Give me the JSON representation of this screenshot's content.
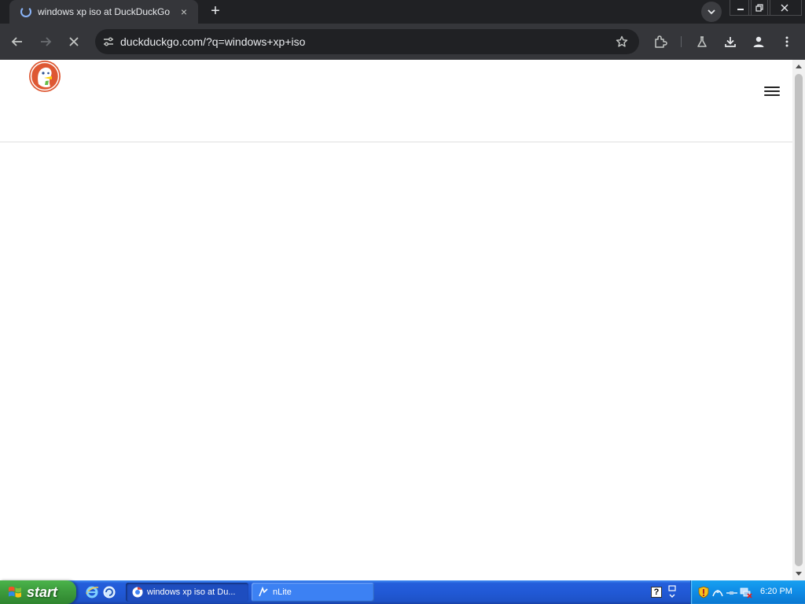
{
  "browser": {
    "tab": {
      "title": "windows xp iso at DuckDuckGo",
      "close_glyph": "×"
    },
    "new_tab_glyph": "+",
    "omnibox": {
      "url": "duckduckgo.com/?q=windows+xp+iso"
    },
    "icons": [
      "back-icon",
      "forward-icon",
      "stop-icon",
      "tune-icon",
      "star-icon",
      "extensions-icon",
      "labs-icon",
      "download-icon",
      "profile-icon",
      "menu-icon"
    ]
  },
  "page": {
    "site": "DuckDuckGo",
    "loading": true
  },
  "taskbar": {
    "start_label": "start",
    "tasks": [
      {
        "label": "windows xp iso at Du...",
        "active": true
      },
      {
        "label": "nLite",
        "active": false
      }
    ],
    "help_glyph": "?",
    "clock": "6:20 PM"
  },
  "colors": {
    "chrome_dark": "#202124",
    "chrome_toolbar": "#35363a",
    "xp_taskbar": "#245edb",
    "xp_start": "#3c9a3c",
    "ddg_orange": "#de5833"
  }
}
